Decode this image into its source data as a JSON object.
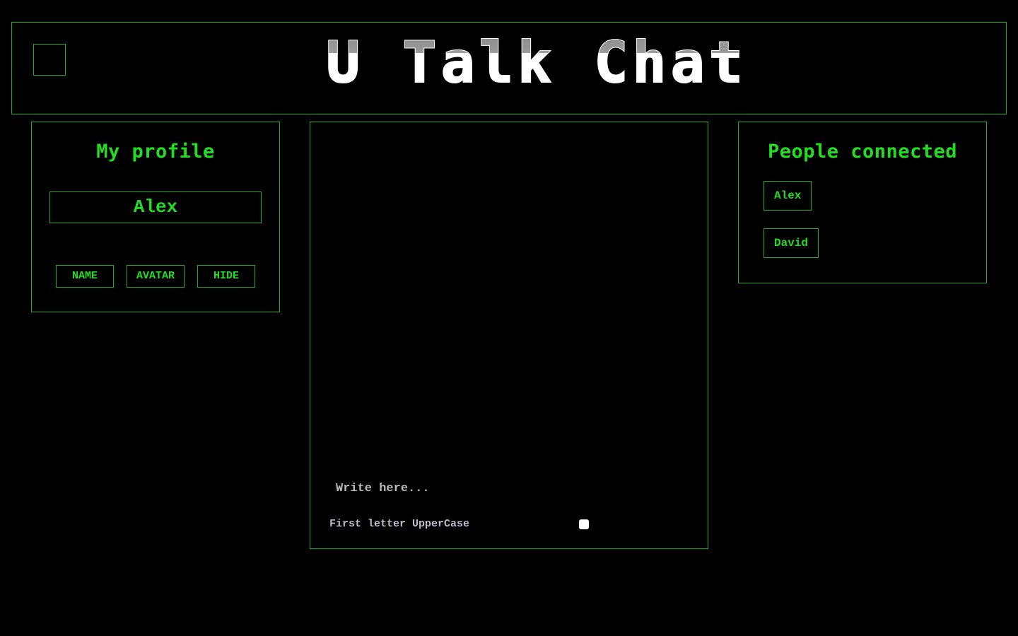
{
  "header": {
    "logo_text": "U Talk Chat"
  },
  "profile": {
    "title": "My profile",
    "name": "Alex",
    "buttons": {
      "name_label": "NAME",
      "avatar_label": "AVATAR",
      "hide_label": "HIDE"
    }
  },
  "chat": {
    "input_placeholder": "Write here...",
    "uppercase_label": "First letter UpperCase",
    "uppercase_checked": false
  },
  "people": {
    "title": "People connected",
    "users": [
      "Alex",
      "David"
    ]
  },
  "colors": {
    "background": "#000000",
    "accent_green": "#22dd22",
    "border_green": "#22aa22",
    "muted_text": "#bbbbbb"
  }
}
